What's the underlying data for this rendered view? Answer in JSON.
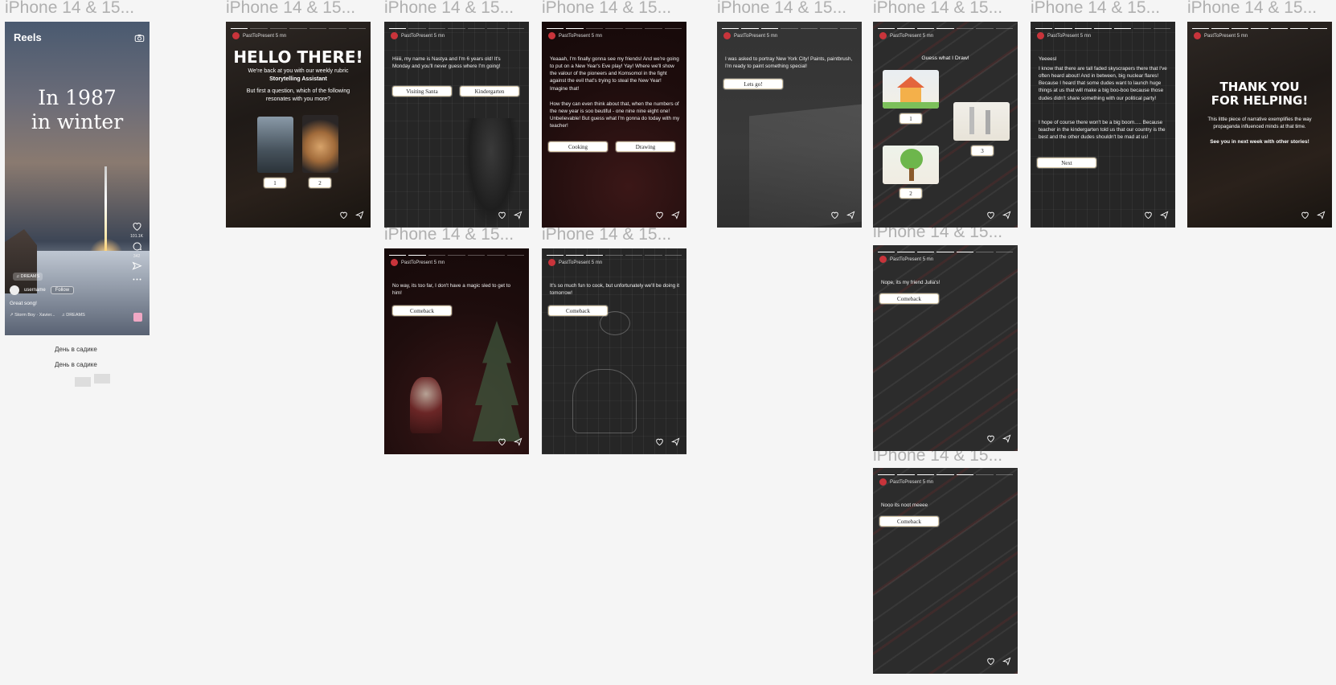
{
  "labels": {
    "frame_title": "iPhone 14 & 15..."
  },
  "reels": {
    "title": "Reels",
    "headline_line1": "In 1987",
    "headline_line2": "in winter",
    "likes": "101.1K",
    "comments": "342",
    "chip": "♫ DREAMS",
    "username": "username",
    "follow": "Follow",
    "caption": "Great song!",
    "music_track": "↗ Storm Boy · Xavier...",
    "music_tag": "♫ DREAMS"
  },
  "notes": {
    "line1": "День в садике",
    "line2": "День в садике"
  },
  "story": {
    "author": "PastToPresent 5 mn"
  },
  "hello": {
    "title": "HELLO THERE!",
    "line1": "We're back at you with our weekly rubric",
    "rubric": "Storytelling Assistant",
    "question": "But first a question, which of the following resonates with you more?",
    "btn1": "1",
    "btn2": "2"
  },
  "nastya": {
    "text": "Hiiiii, my name is Nastya and I'm 6 years old! It's Monday and you'll never guess where I'm going!",
    "btn_santa": "Visiting Santa",
    "btn_kinder": "Kindergarten"
  },
  "newyear": {
    "text1": "Yeaaah, I'm finally gonna see my friends! And we're going to put on a New Year's Eve play! Yay! Where we'll show the valour of the pioneers and Komsomol in the fight against the evil that's trying to steal the New Year! Imagine that!",
    "text2": "How they can even think about that, when the numbers of the new year is soo beutiful - one nine nine eight one! Unbelievable! But guess what I'm gonna do today with my teacher!",
    "btn_cooking": "Cooking",
    "btn_drawing": "Drawing"
  },
  "nyc": {
    "text": "I was asked to portray New York City! Paints, paintbrush, I'm ready to paint something special!",
    "btn": "Lets go!"
  },
  "guess": {
    "title": "Guess what I Draw!",
    "btn1": "1",
    "btn2": "2",
    "btn3": "3"
  },
  "yeees": {
    "text1": "Yeeeesl",
    "text2": "I know that there are tall faded skyscrapers there that I've often heard about! And in between, big nuclear flares! Because I heard that some dudes want to launch huge things at us that will make a big boo-boo because those dudes didn't share something with our political party!",
    "text3": "I hope of course there won't be a big boom..... Because teacher in the kindergarten told us that our country is the best and the other dudes shouldn't be mad at us!",
    "btn": "Next"
  },
  "thanks": {
    "title1": "THANK YOU",
    "title2": "FOR HELPING!",
    "text": "This little piece of narrative exemplifies the way propaganda influenced minds at that time.",
    "bold": "See you in next week with other stories!"
  },
  "magicsled": {
    "text": "No way, its too far, I don't have a magic sled to get to him!",
    "btn": "Comeback"
  },
  "cookfun": {
    "text": "It's so much fun to cook, but unfortunately we'll be doing it tomorrow!",
    "btn": "Comeback"
  },
  "julia": {
    "text": "Nope, its my friend Julia's!",
    "btn": "Comeback"
  },
  "nooo": {
    "text": "Nooo its noot meeee",
    "btn": "Comeback"
  },
  "colors": {
    "accent_red": "#c8343b",
    "canvas": "#f5f5f5",
    "label_gray": "#b0b0b0",
    "button_bg": "#ffffff"
  }
}
